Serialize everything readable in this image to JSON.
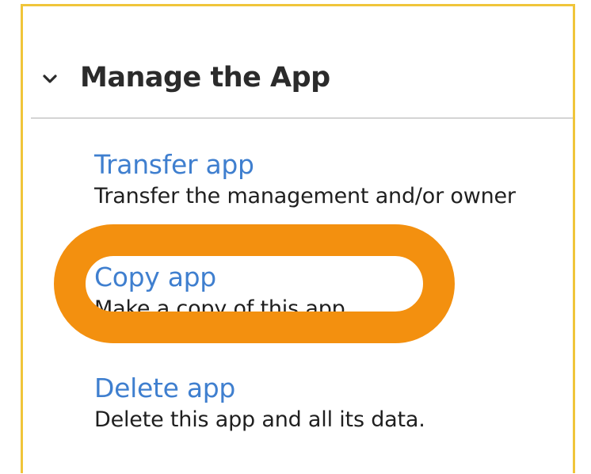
{
  "section": {
    "title": "Manage the App",
    "expanded_icon": "chevron-down-icon"
  },
  "items": [
    {
      "label": "Transfer app",
      "description": "Transfer the management and/or owner"
    },
    {
      "label": "Copy app",
      "description": "Make a copy of this app."
    },
    {
      "label": "Delete app",
      "description": "Delete this app and all its data."
    }
  ],
  "colors": {
    "link": "#3f7fcf",
    "highlight": "#f3900f",
    "frame_border": "#f0c53a",
    "title": "#2b2b2b"
  }
}
